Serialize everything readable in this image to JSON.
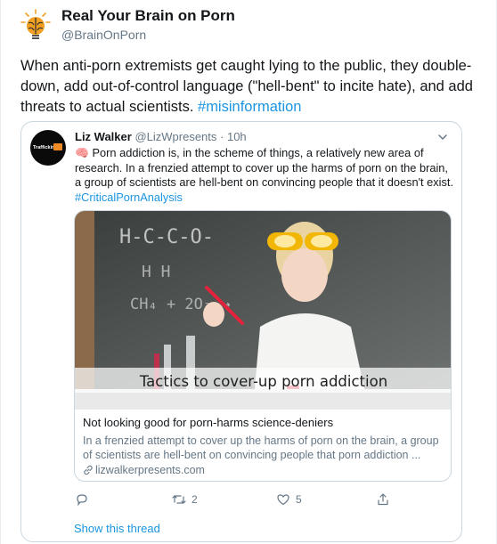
{
  "author": {
    "name": "Real Your Brain on Porn",
    "handle": "@BrainOnPorn",
    "avatar_icon": "brain-lightbulb-icon"
  },
  "tweet": {
    "text": "When anti-porn extremists get caught lying to the public, they double-down, add out-of-control language (\"hell-bent\" to incite hate), and add threats to actual scientists. ",
    "hashtag": "#misinformation"
  },
  "quoted": {
    "name": "Liz Walker",
    "handle": "@LizWpresents",
    "separator": " · ",
    "time": "10h",
    "avatar_text": "Trafficking",
    "text_emoji": "🧠",
    "text": " Porn addiction is, in the scheme of things, a relatively new area of research. In a frenzied attempt to cover up the harms of porn on the brain, a group of scientists are hell-bent on convincing people that it doesn't exist.",
    "hashtag": "#CriticalPornAnalysis",
    "card": {
      "overlay_text": "Tactics to cover-up porn addiction",
      "title": "Not looking good for porn-harms science-deniers",
      "description": "In a frenzied attempt to cover up the harms of porn on the brain, a group of scientists are hell-bent on convincing people that porn addiction ...",
      "domain": "lizwalkerpresents.com",
      "chalk_text": "H-C-C-O-"
    },
    "actions": {
      "reply_count": "",
      "retweet_count": "2",
      "like_count": "5"
    },
    "show_thread": "Show this thread"
  },
  "colors": {
    "link_blue": "#1b95e0",
    "muted_gray": "#657786",
    "border": "#ccd6dd"
  }
}
